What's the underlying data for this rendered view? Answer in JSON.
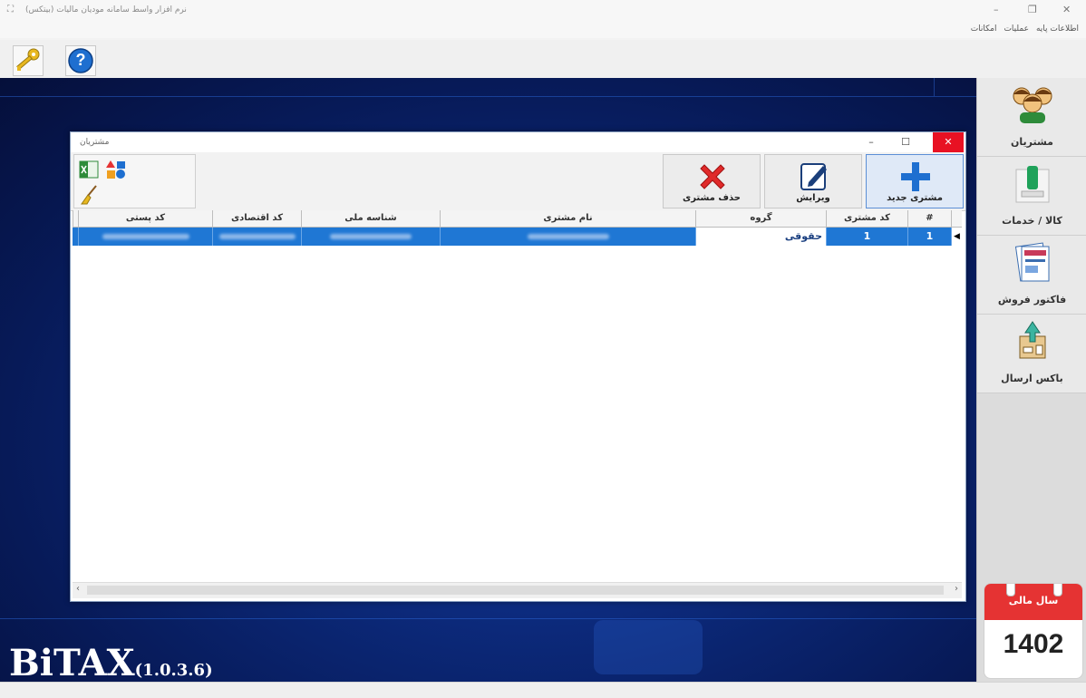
{
  "app": {
    "title": "نرم افزار واسط سامانه مودیان مالیات (بیتکس)",
    "window_controls": [
      "–",
      "❐",
      "✕"
    ],
    "menu": [
      "اطلاعات پایه",
      "عملیات",
      "امکانات"
    ]
  },
  "toolbar": {
    "key_icon": "key-icon",
    "help_icon": "help-icon",
    "help_glyph": "?"
  },
  "brand": {
    "name": "BiTAX",
    "version": "(1.0.3.6)"
  },
  "sidebar": {
    "items": [
      {
        "label": "مشتریان",
        "icon": "customers-icon"
      },
      {
        "label": "کالا / خدمات",
        "icon": "products-icon"
      },
      {
        "label": "فاکتور فروش",
        "icon": "invoice-icon"
      },
      {
        "label": "باکس ارسال",
        "icon": "send-box-icon"
      }
    ],
    "calendar": {
      "label": "سال مالی",
      "year": "1402"
    }
  },
  "dialog": {
    "title": "مشتریان",
    "controls": [
      "–",
      "☐",
      "✕"
    ],
    "actions": [
      {
        "label": "مشتری جدید",
        "icon": "plus-icon"
      },
      {
        "label": "ویرایش",
        "icon": "edit-icon"
      },
      {
        "label": "حذف مشتری",
        "icon": "delete-icon"
      }
    ],
    "grid": {
      "columns": [
        "#",
        "کد مشتری",
        "گروه",
        "نام مشتری",
        "شناسه ملی",
        "کد اقتصادی",
        "کد پستی"
      ],
      "rows": [
        {
          "index": "1",
          "code": "1",
          "group": "حقوقی"
        }
      ]
    }
  },
  "colors": {
    "accent": "#1f77d4",
    "desktop": "#0c2a7c",
    "calendar": "#e53333"
  }
}
